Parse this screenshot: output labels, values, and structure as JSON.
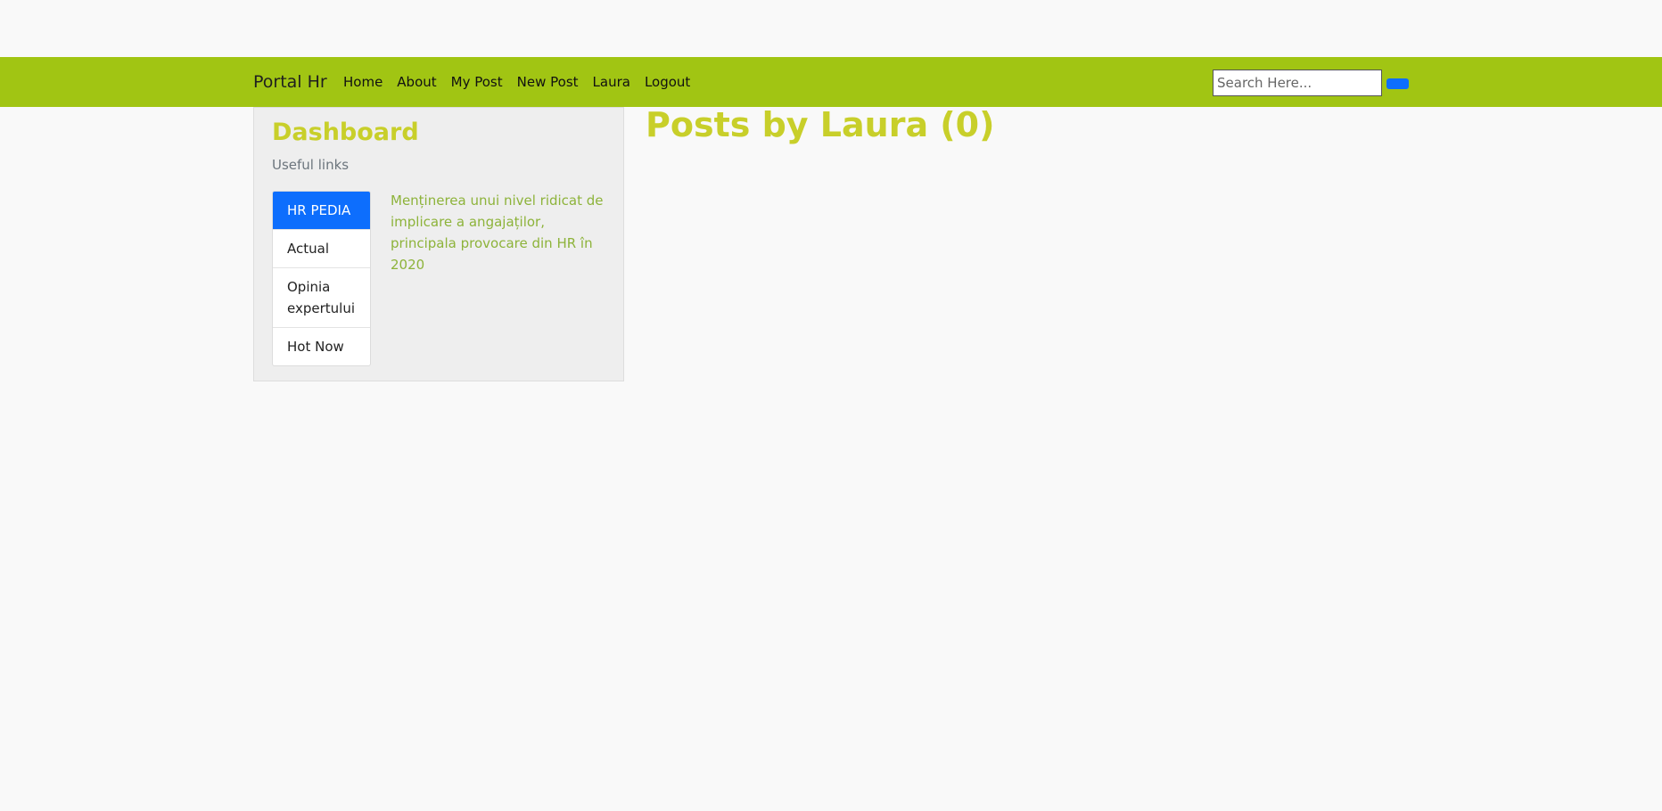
{
  "navbar": {
    "brand": "Portal Hr",
    "links": [
      "Home",
      "About",
      "My Post",
      "New Post",
      "Laura",
      "Logout"
    ],
    "search_placeholder": "Search Here..."
  },
  "sidebar": {
    "title": "Dashboard",
    "subtitle": "Useful links",
    "items": [
      {
        "label": "HR PEDIA",
        "active": true
      },
      {
        "label": "Actual",
        "active": false
      },
      {
        "label": "Opinia expertului",
        "active": false
      },
      {
        "label": "Hot Now",
        "active": false
      }
    ],
    "content_text": "Menținerea unui nivel ridicat de implicare a angajaților, principala provocare din HR în 2020"
  },
  "main": {
    "title": "Posts by Laura (0)"
  },
  "colors": {
    "navbar_bg": "#a1c513",
    "accent_title": "#c8cf2a",
    "active_item": "#0d6efd",
    "content_text": "#8db33a"
  }
}
